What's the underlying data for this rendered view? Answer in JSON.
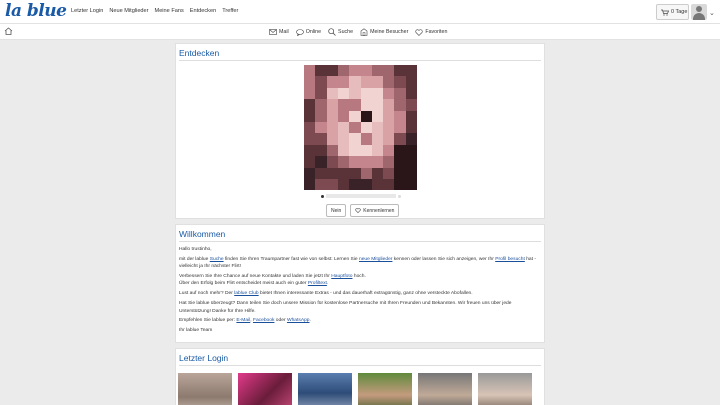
{
  "header": {
    "logo": "la blue",
    "nav": [
      "Letzter Login",
      "Neue Mitglieder",
      "Meine Fans",
      "Entdecken",
      "Treffer"
    ],
    "days_label": "0 Tage"
  },
  "subnav": {
    "items": [
      {
        "label": "Mail",
        "icon": "mail-icon"
      },
      {
        "label": "Online",
        "icon": "chat-bubble-icon"
      },
      {
        "label": "Suche",
        "icon": "search-icon"
      },
      {
        "label": "Meine Besucher",
        "icon": "visitors-icon"
      },
      {
        "label": "Favoriten",
        "icon": "heart-icon"
      }
    ]
  },
  "discover": {
    "title": "Entdecken",
    "btn_no": "Nein",
    "btn_meet": "Kennenlernen"
  },
  "welcome": {
    "title": "Willkommen",
    "greeting": "Hallo trustinho,",
    "p1a": "mit der lablue ",
    "p1_link1": "Suche",
    "p1b": " finden Sie Ihren Traumpartner fast wie von selbst: Lernen Sie ",
    "p1_link2": "neue Mitglieder",
    "p1c": " kennen oder lassen Sie sich anzeigen, wer Ihr ",
    "p1_link3": "Profil besucht",
    "p1d": " hat - vielleicht ja Ihr nächster Flirt!",
    "p2a": "Verbessern Sie Ihre Chance auf neue Kontakte und laden Sie jetzt Ihr ",
    "p2_link": "Hauptfoto",
    "p2b": " hoch.",
    "p3a": "Über den Erfolg beim Flirt entscheidet meist auch ein guter ",
    "p3_link": "Profiltext",
    "p3b": ".",
    "p4a": "Lust auf noch mehr? Der ",
    "p4_link": "lablue Club",
    "p4b": " bietet Ihnen interessante Extras - und das dauerhaft extragünstig, ganz ohne versteckte Abofallen.",
    "p5": "Hat Sie lablue überzeugt? Dann teilen Sie doch unsere Mission für kostenlose Partnersuche mit Ihren Freunden und Bekannten. Wir freuen uns über jede Unterstützung! Danke für Ihre Hilfe.",
    "p6a": "Empfehlen Sie lablue per: ",
    "p6_link1": "E-Mail",
    "p6_sep": ", ",
    "p6_link2": "Facebook",
    "p6_or": " oder ",
    "p6_link3": "WhatsApp",
    "p6b": ".",
    "sign": "Ihr lablue Team"
  },
  "last_login": {
    "title": "Letzter Login"
  },
  "colors": {
    "accent": "#1a5aa6",
    "link": "#1a4f9c",
    "background": "#ebebeb"
  }
}
